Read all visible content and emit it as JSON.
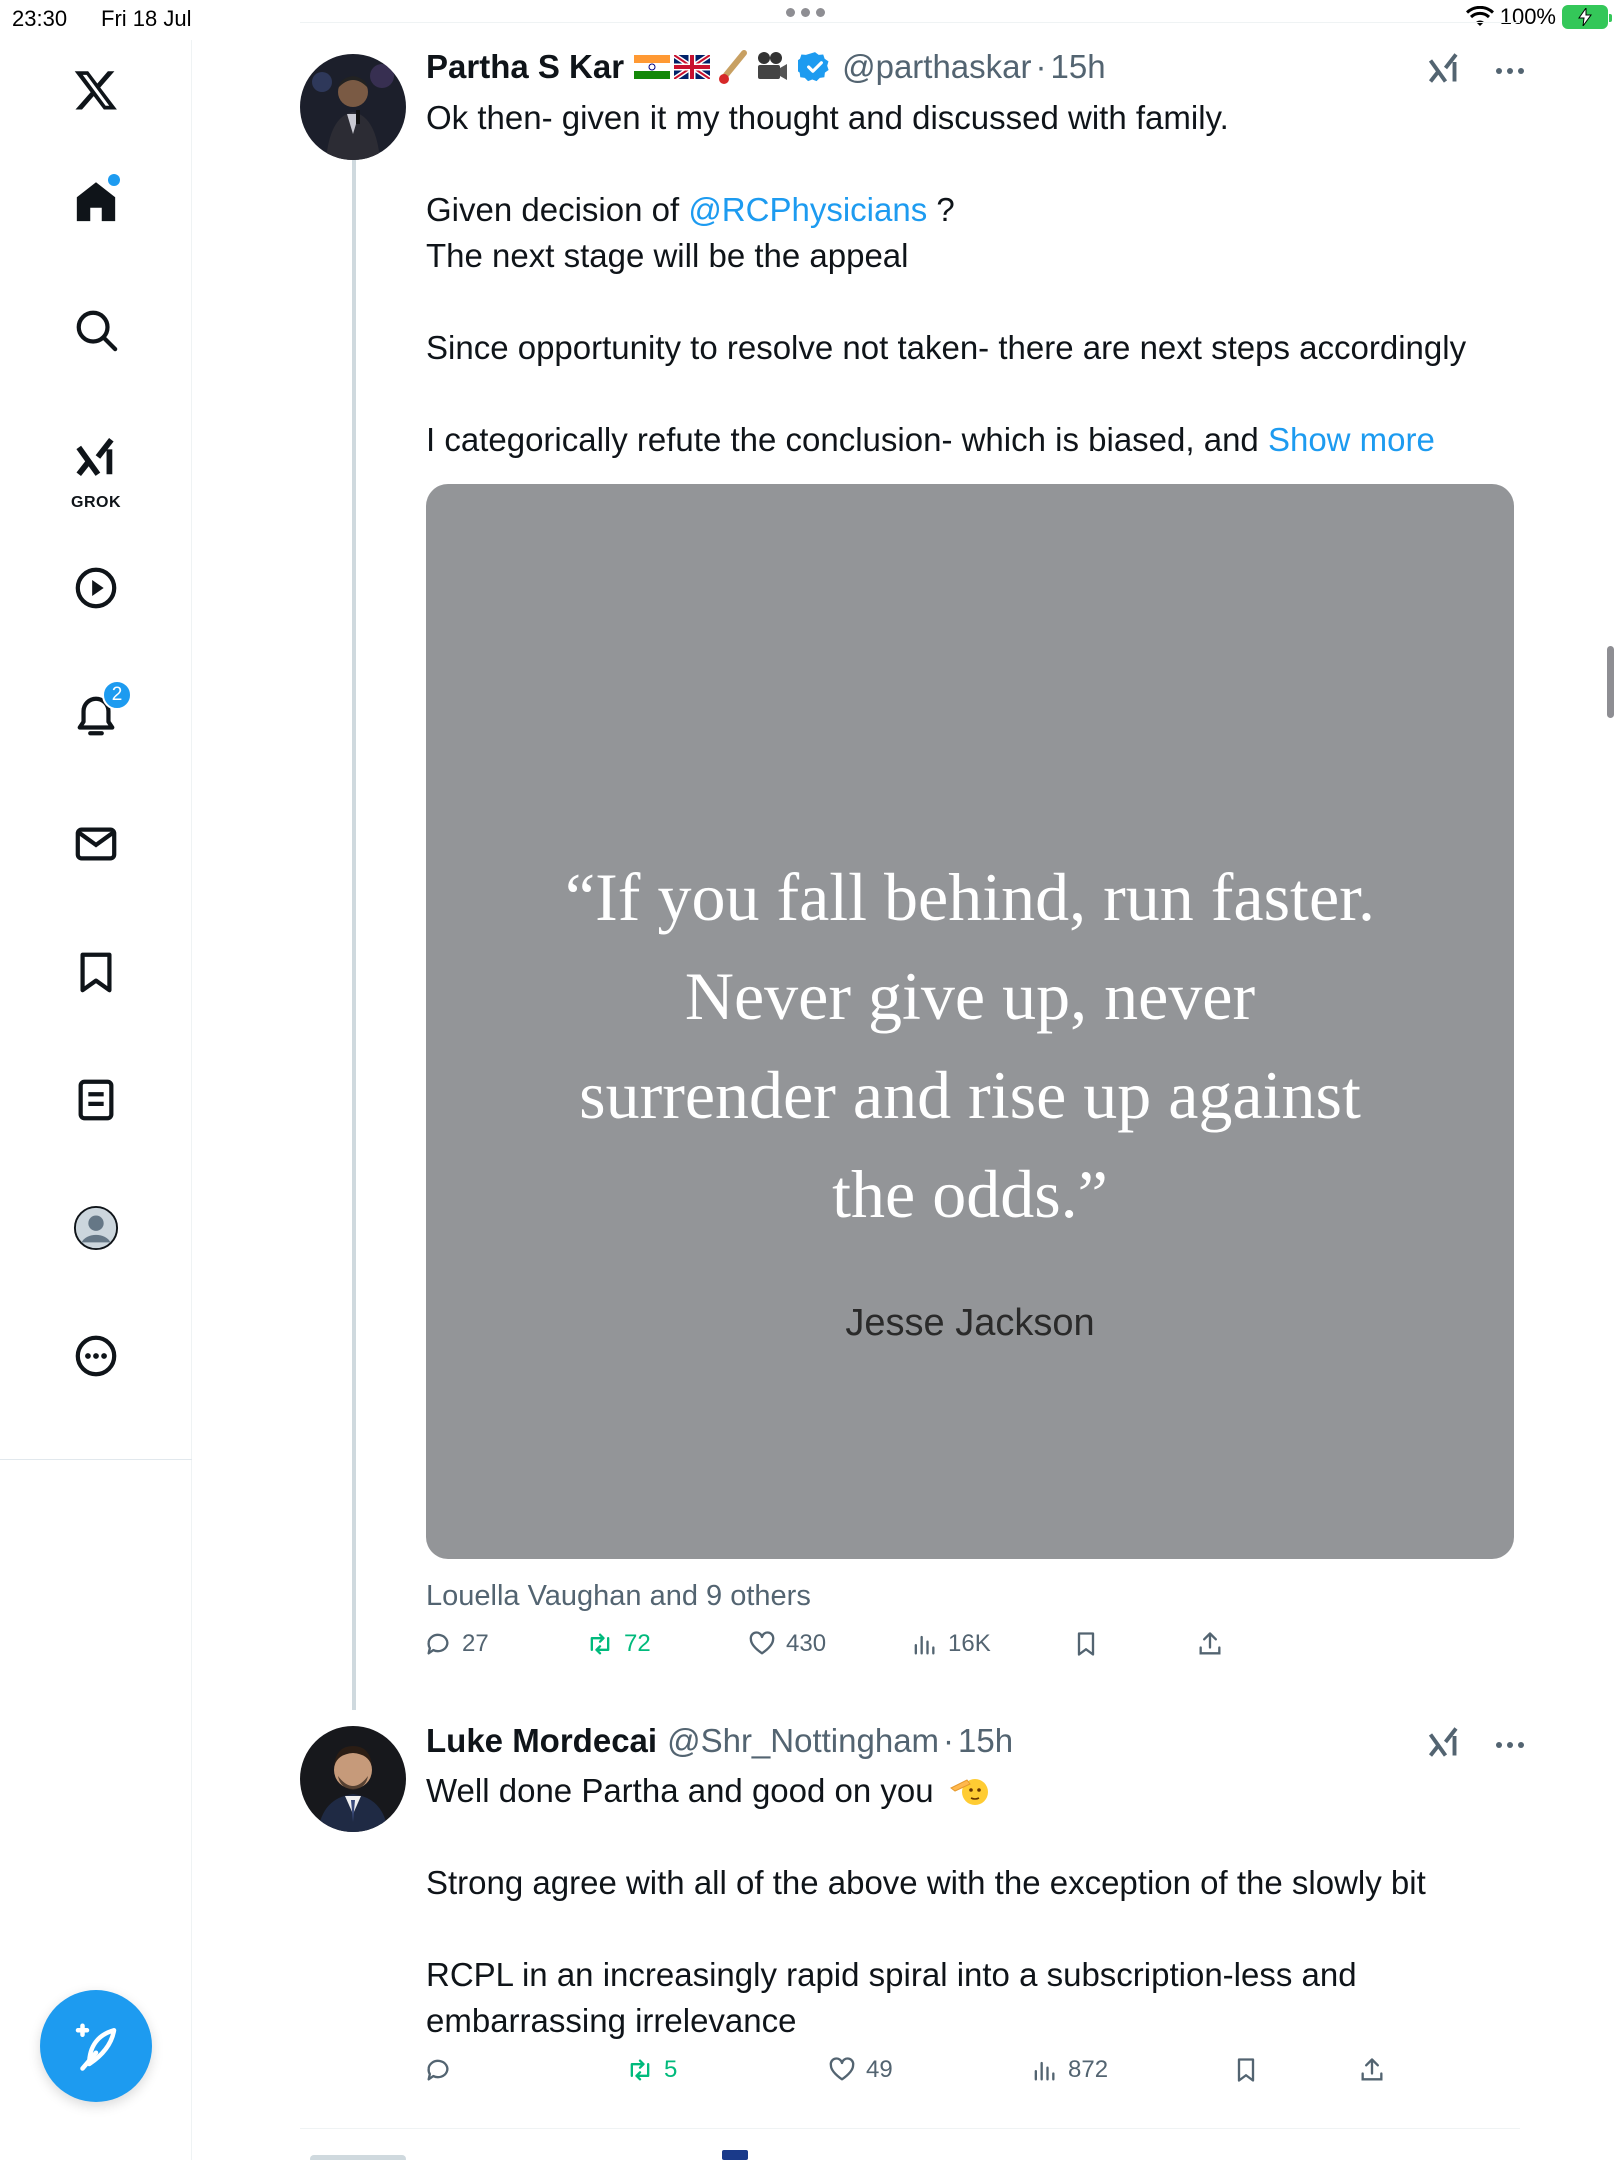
{
  "status_bar": {
    "time": "23:30",
    "date": "Fri 18 Jul",
    "battery": "100%",
    "battery_color": "#34c759"
  },
  "sidebar": {
    "items": [
      {
        "name": "x-logo-icon"
      },
      {
        "name": "home-icon",
        "has_notification_dot": true
      },
      {
        "name": "search-icon"
      },
      {
        "name": "grok-icon",
        "label": "GROK"
      },
      {
        "name": "video-icon"
      },
      {
        "name": "notifications-icon",
        "badge": "2"
      },
      {
        "name": "messages-icon"
      },
      {
        "name": "bookmarks-icon"
      },
      {
        "name": "lists-icon"
      },
      {
        "name": "profile-avatar-icon"
      },
      {
        "name": "more-icon"
      }
    ],
    "compose_icon": "compose-post-icon",
    "accent": "#1d9bf0"
  },
  "posts": [
    {
      "name": "Partha S Kar",
      "emoji_badges": [
        "india-flag",
        "uk-flag",
        "cricket-bat",
        "movie-camera"
      ],
      "verified": true,
      "handle": "@parthaskar",
      "separator": "·",
      "time": "15h",
      "text": {
        "l1": "Ok then- given it my thought and discussed with family.",
        "l2_pre": "Given decision of ",
        "l2_mention": "@RCPhysicians",
        "l2_post": " ?",
        "l3": "The next stage will be the appeal",
        "l4": "Since opportunity to resolve not taken- there are next steps accordingly",
        "l5_pre": "I categorically refute the conclusion- which is biased, and ",
        "l5_link": "Show more"
      },
      "media": {
        "quote": "“If you fall behind, run faster. Never give up, never surrender and rise up against the odds.”",
        "quote_lines": [
          "“If you fall behind, run faster.",
          "Never give up, never",
          "surrender and rise up against",
          "the odds.”"
        ],
        "author": "Jesse Jackson",
        "background": "#939598"
      },
      "liked_by": "Louella Vaughan and 9 others",
      "actions": {
        "replies": "27",
        "reposts": "72",
        "likes": "430",
        "views": "16K"
      }
    },
    {
      "name": "Luke Mordecai",
      "handle": "@Shr_Nottingham",
      "separator": "·",
      "time": "15h",
      "text": {
        "l1": "Well done Partha and good on you",
        "l1_emoji": "saluting-face",
        "l2": "Strong agree with all of the above with the exception of the slowly bit",
        "l3": "RCPL in an increasingly rapid spiral into a subscription-less and",
        "l4": "embarrassing irrelevance"
      },
      "actions": {
        "replies": "",
        "reposts": "5",
        "likes": "49",
        "views": "872"
      }
    }
  ],
  "colors": {
    "link": "#1d9bf0",
    "repost_active": "#00ba7c",
    "secondary_text": "#536471",
    "verified": "#1d9bf0"
  }
}
